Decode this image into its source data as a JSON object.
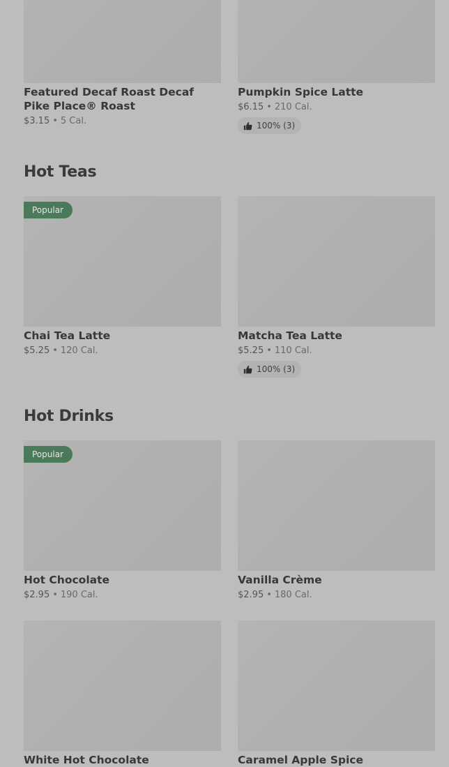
{
  "top_row": [
    {
      "name": "Featured Decaf Roast Decaf Pike Place® Roast",
      "price": "$3.15",
      "calories": "5 Cal."
    },
    {
      "name": "Pumpkin Spice Latte",
      "price": "$6.15",
      "calories": "210 Cal.",
      "rating": "100% (3)"
    }
  ],
  "sections": [
    {
      "title": "Hot Teas",
      "items": [
        {
          "name": "Chai Tea Latte",
          "price": "$5.25",
          "calories": "120 Cal.",
          "badge": "Popular"
        },
        {
          "name": "Matcha Tea Latte",
          "price": "$5.25",
          "calories": "110 Cal.",
          "rating": "100% (3)"
        }
      ]
    },
    {
      "title": "Hot Drinks",
      "items": [
        {
          "name": "Hot Chocolate",
          "price": "$2.95",
          "calories": "190 Cal.",
          "badge": "Popular"
        },
        {
          "name": "Vanilla Crème",
          "price": "$2.95",
          "calories": "180 Cal."
        },
        {
          "name": "White Hot Chocolate"
        },
        {
          "name": "Caramel Apple Spice"
        }
      ]
    }
  ],
  "separator": "•",
  "icons": {
    "rating": "thumbs-up-icon"
  },
  "colors": {
    "badge_bg": "#4b7a5b",
    "background": "#bdbdbd",
    "image_placeholder": "#b0b0b0"
  }
}
